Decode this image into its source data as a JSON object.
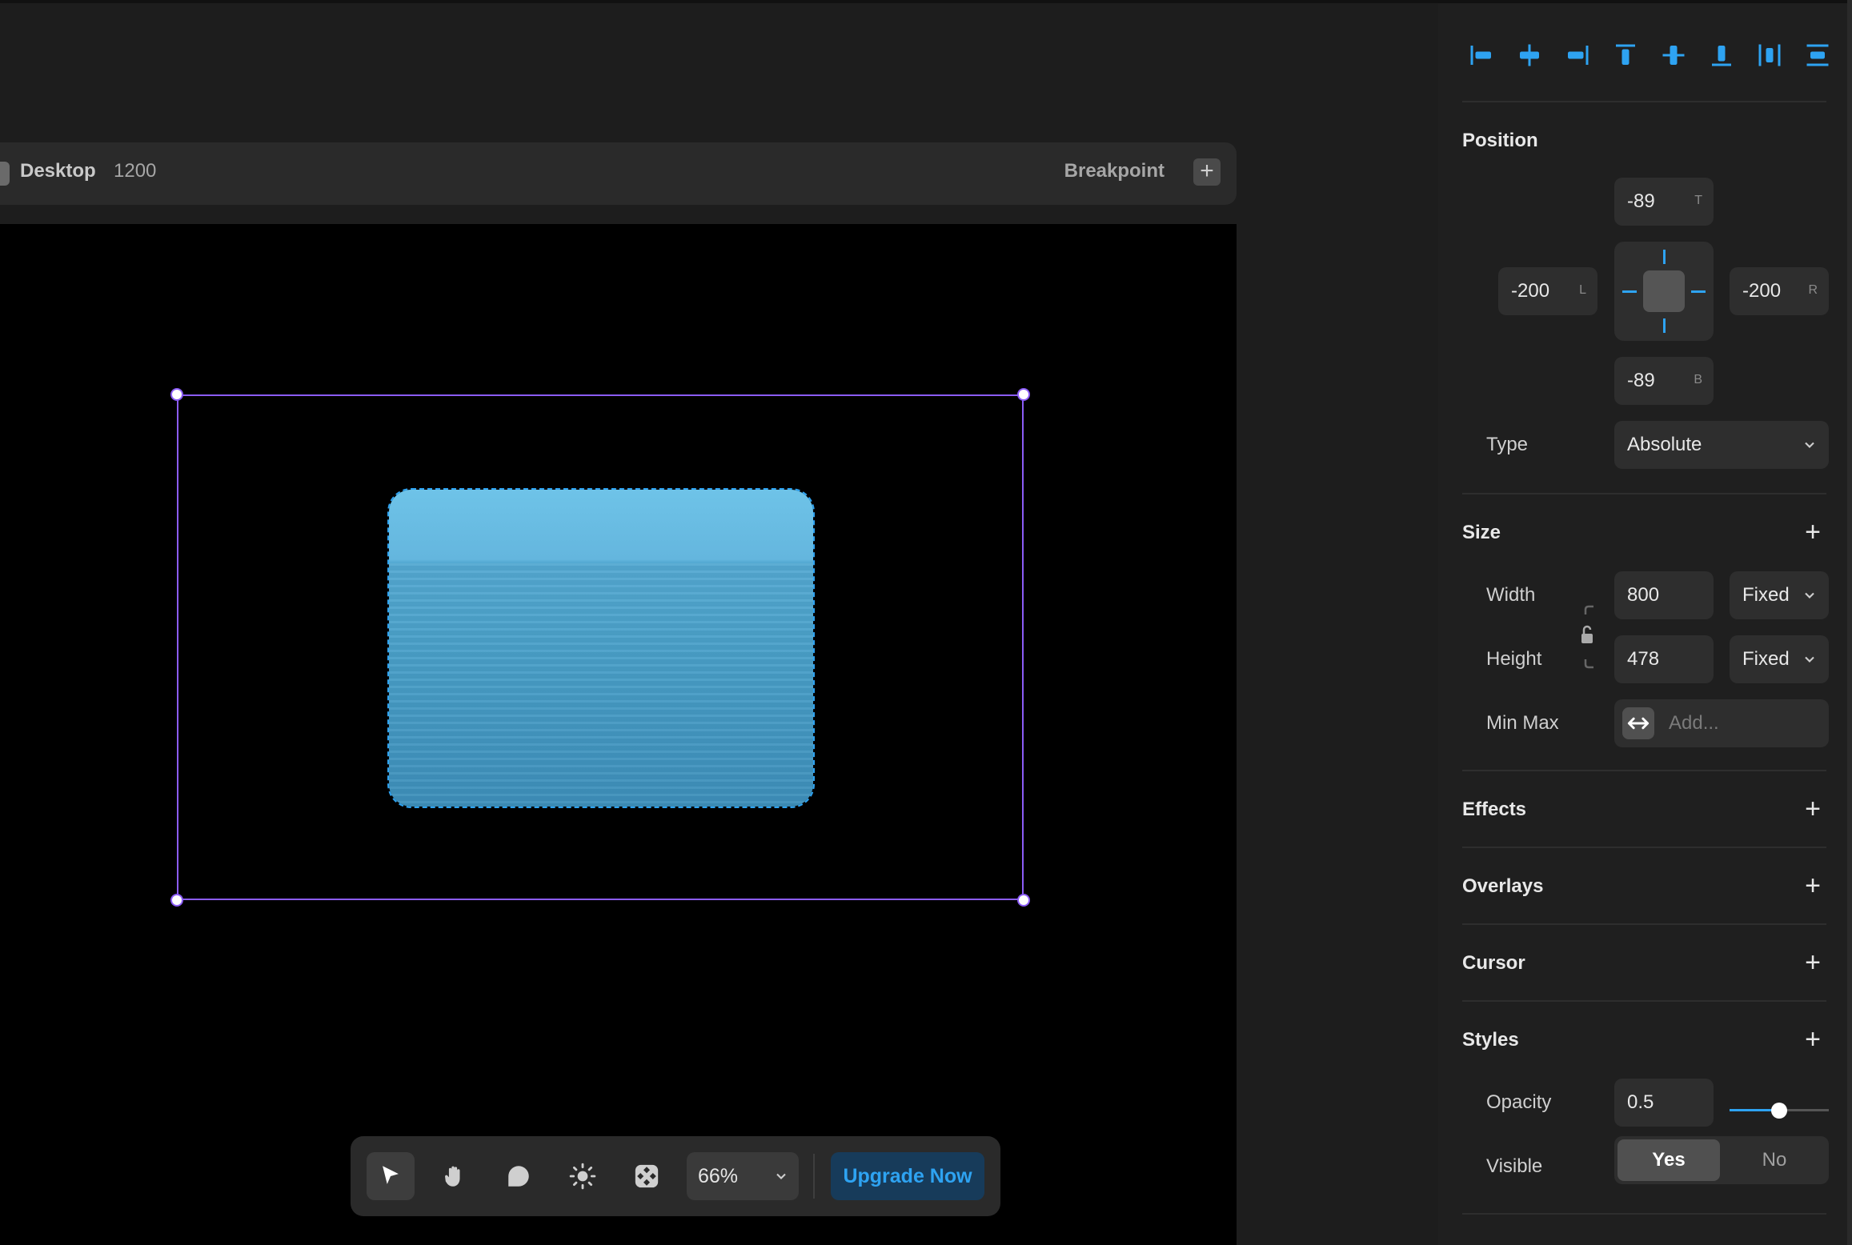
{
  "breakpoint_bar": {
    "device_label": "Desktop",
    "device_width": "1200",
    "breakpoint_label": "Breakpoint",
    "add_symbol": "+"
  },
  "toolbar": {
    "zoom_value": "66%",
    "upgrade_label": "Upgrade Now",
    "tools": [
      {
        "name": "select",
        "icon": "arrow-cursor-icon",
        "active": true
      },
      {
        "name": "hand",
        "icon": "hand-icon"
      },
      {
        "name": "comment",
        "icon": "comment-bubble-icon"
      },
      {
        "name": "theme",
        "icon": "sun-icon"
      },
      {
        "name": "components",
        "icon": "components-grid-icon"
      }
    ]
  },
  "panel": {
    "align_icons": [
      "align-left-icon",
      "align-center-h-icon",
      "align-right-icon",
      "align-top-icon",
      "align-center-v-icon",
      "align-bottom-icon",
      "distribute-h-icon",
      "distribute-v-icon"
    ],
    "position": {
      "title": "Position",
      "top": "-89",
      "top_suffix": "T",
      "left": "-200",
      "left_suffix": "L",
      "right": "-200",
      "right_suffix": "R",
      "bottom": "-89",
      "bottom_suffix": "B",
      "type_label": "Type",
      "type_value": "Absolute"
    },
    "size": {
      "title": "Size",
      "add_symbol": "+",
      "width_label": "Width",
      "width_value": "800",
      "width_mode": "Fixed",
      "height_label": "Height",
      "height_value": "478",
      "height_mode": "Fixed",
      "minmax_label": "Min Max",
      "minmax_placeholder": "Add..."
    },
    "effects": {
      "title": "Effects",
      "add_symbol": "+"
    },
    "overlays": {
      "title": "Overlays",
      "add_symbol": "+"
    },
    "cursor": {
      "title": "Cursor",
      "add_symbol": "+"
    },
    "styles": {
      "title": "Styles",
      "add_symbol": "+",
      "opacity_label": "Opacity",
      "opacity_value": "0.5",
      "opacity_fraction": 0.5,
      "visible_label": "Visible",
      "visible_yes": "Yes",
      "visible_no": "No"
    }
  },
  "colors": {
    "accent": "#2ea3f2",
    "selection": "#8b5cf6",
    "panel_bg": "#1f1f1f",
    "canvas_bg": "#000000"
  }
}
